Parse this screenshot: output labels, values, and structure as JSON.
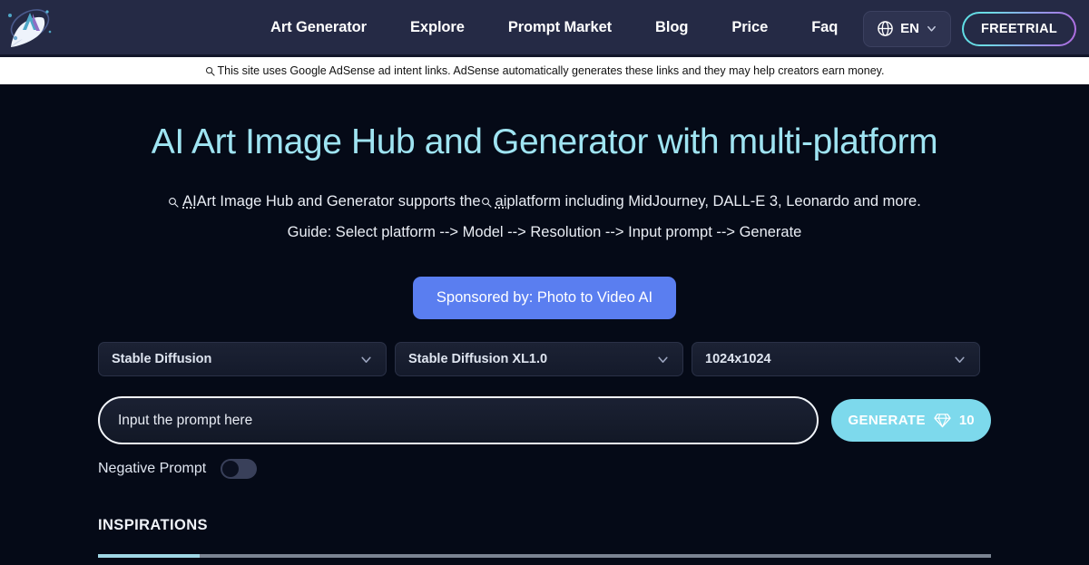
{
  "header": {
    "logo_name": "ai-art-rocket-logo",
    "nav": [
      {
        "label": "Art Generator"
      },
      {
        "label": "Explore"
      },
      {
        "label": "Prompt Market"
      },
      {
        "label": "Blog"
      },
      {
        "label": "Price"
      },
      {
        "label": "Faq"
      }
    ],
    "language": {
      "label": "EN",
      "icon": "globe-icon",
      "chevron": "chevron-down-icon"
    },
    "cta": {
      "label": "FREETRIAL"
    },
    "colors": {
      "background": "#252a45",
      "accent_cyan": "#5de0e6",
      "accent_purple": "#b06ae0"
    }
  },
  "adsense_bar": {
    "icon": "search-icon",
    "text": "This site uses Google AdSense ad intent links. AdSense automatically generates these links and they may help creators earn money."
  },
  "hero": {
    "title": "AI Art Image Hub and Generator with multi-platform",
    "subtitle_parts": {
      "icon1": "search-icon",
      "link1": "AI",
      "mid": " Art Image Hub and Generator supports the ",
      "icon2": "search-icon",
      "link2": "ai",
      "tail": " platform including MidJourney, DALL-E 3, Leonardo and more."
    },
    "guide": "Guide: Select platform --> Model --> Resolution --> Input prompt --> Generate",
    "title_color": "#9fe4f2"
  },
  "sponsor": {
    "label": "Sponsored by: Photo to Video AI",
    "color": "#5a7ef0"
  },
  "controls": {
    "platform_select": {
      "value": "Stable Diffusion",
      "icon": "chevron-down-icon"
    },
    "model_select": {
      "value": "Stable Diffusion XL1.0",
      "icon": "chevron-down-icon"
    },
    "resolution_select": {
      "value": "1024x1024",
      "icon": "chevron-down-icon"
    },
    "prompt": {
      "value": "",
      "placeholder": "Input the prompt here"
    },
    "generate": {
      "label": "GENERATE",
      "icon": "gem-icon",
      "cost": "10",
      "color": "#7dd9ec"
    },
    "negative_prompt": {
      "label": "Negative Prompt",
      "enabled": false
    }
  },
  "inspirations": {
    "title": "INSPIRATIONS"
  }
}
